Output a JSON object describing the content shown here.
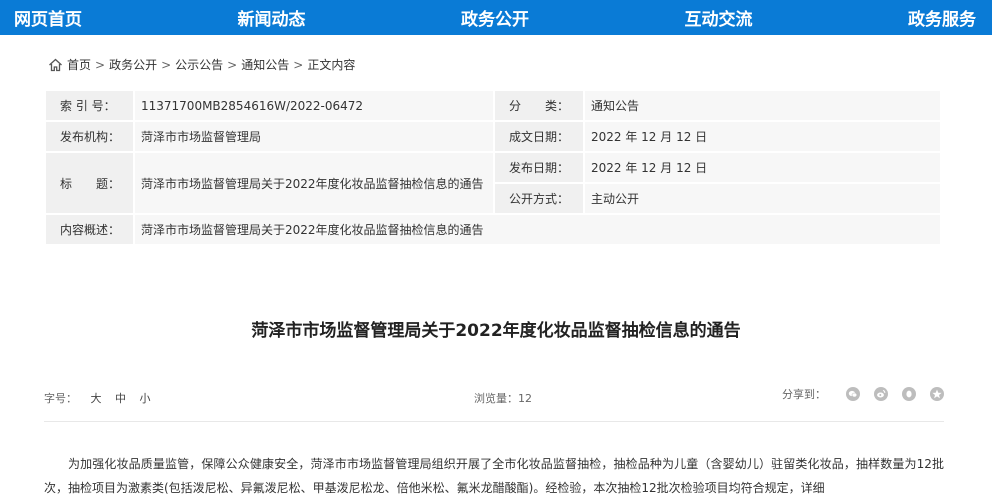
{
  "nav": {
    "items": [
      "网页首页",
      "新闻动态",
      "政务公开",
      "互动交流",
      "政务服务"
    ]
  },
  "breadcrumb": {
    "items": [
      "首页",
      "政务公开",
      "公示公告",
      "通知公告",
      "正文内容"
    ],
    "separator": ">"
  },
  "meta": {
    "index_label": "索 引 号：",
    "index_value": "11371700MB2854616W/2022-06472",
    "category_label": "分　　类：",
    "category_value": "通知公告",
    "publisher_label": "发布机构：",
    "publisher_value": "菏泽市市场监督管理局",
    "created_label": "成文日期：",
    "created_value": "2022 年 12 月 12 日",
    "title_label": "标　　题：",
    "title_value": "菏泽市市场监督管理局关于2022年度化妆品监督抽检信息的通告",
    "published_label": "发布日期：",
    "published_value": "2022 年 12 月 12 日",
    "mode_label": "公开方式：",
    "mode_value": "主动公开",
    "summary_label": "内容概述：",
    "summary_value": "菏泽市市场监督管理局关于2022年度化妆品监督抽检信息的通告"
  },
  "article": {
    "title": "菏泽市市场监督管理局关于2022年度化妆品监督抽检信息的通告",
    "fontsize_label": "字号：",
    "fontsize_large": "大",
    "fontsize_medium": "中",
    "fontsize_small": "小",
    "views": "浏览量：12",
    "share_label": "分享到：",
    "body": "为加强化妆品质量监管，保障公众健康安全，菏泽市市场监督管理局组织开展了全市化妆品监督抽检，抽检品种为儿童（含婴幼儿）驻留类化妆品，抽样数量为12批次，抽检项目为激素类(包括泼尼松、异氟泼尼松、甲基泼尼松龙、倍他米松、氟米龙醋酸酯)。经检验，本次抽检12批次检验项目均符合规定，详细"
  },
  "icons": {
    "home": "home-icon",
    "share": [
      "wechat-icon",
      "weibo-icon",
      "qq-icon",
      "qzone-icon"
    ]
  },
  "colors": {
    "nav_bg": "#0a7bd6",
    "label_bg": "#f0f0f0",
    "value_bg": "#f7f7f7"
  }
}
